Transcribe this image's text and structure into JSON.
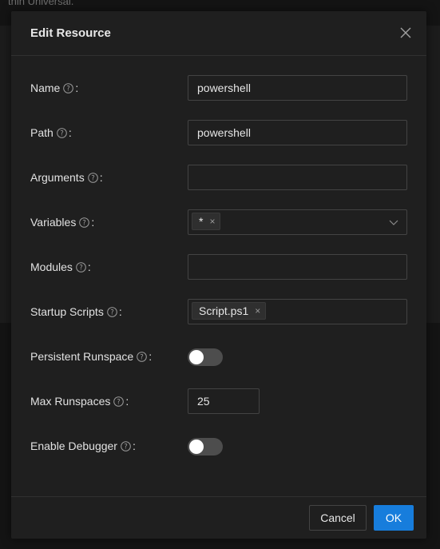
{
  "background": {
    "text": "thin Universal."
  },
  "modal": {
    "title": "Edit Resource",
    "close_icon": "close-icon"
  },
  "fields": {
    "name": {
      "label": "Name",
      "value": "powershell"
    },
    "path": {
      "label": "Path",
      "value": "powershell"
    },
    "arguments": {
      "label": "Arguments",
      "value": ""
    },
    "variables": {
      "label": "Variables",
      "tags": [
        "*"
      ]
    },
    "modules": {
      "label": "Modules",
      "value": ""
    },
    "startup_scripts": {
      "label": "Startup Scripts",
      "tags": [
        "Script.ps1"
      ]
    },
    "persistent_runspace": {
      "label": "Persistent Runspace",
      "enabled": false
    },
    "max_runspaces": {
      "label": "Max Runspaces",
      "value": "25"
    },
    "enable_debugger": {
      "label": "Enable Debugger",
      "enabled": false
    }
  },
  "colon": ":",
  "tag_remove": "×",
  "footer": {
    "cancel_label": "Cancel",
    "ok_label": "OK"
  },
  "colors": {
    "primary": "#177ddc",
    "modal_bg": "#1f1f1f",
    "switch_off": "#4d4d4d"
  }
}
